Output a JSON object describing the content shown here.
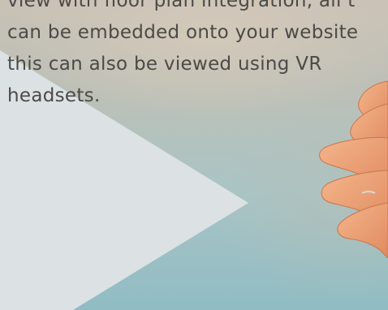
{
  "description": {
    "lines": [
      "view with floor plan integration, all t",
      "can be embedded onto your website",
      "this can also be viewed using VR",
      "headsets."
    ]
  },
  "colors": {
    "text": "#4c4a47",
    "triangle": "#dce1e3",
    "background": "#a9c0c1"
  },
  "icons": {
    "hand": "waving-hand-photo",
    "play": "play-triangle-shape"
  }
}
